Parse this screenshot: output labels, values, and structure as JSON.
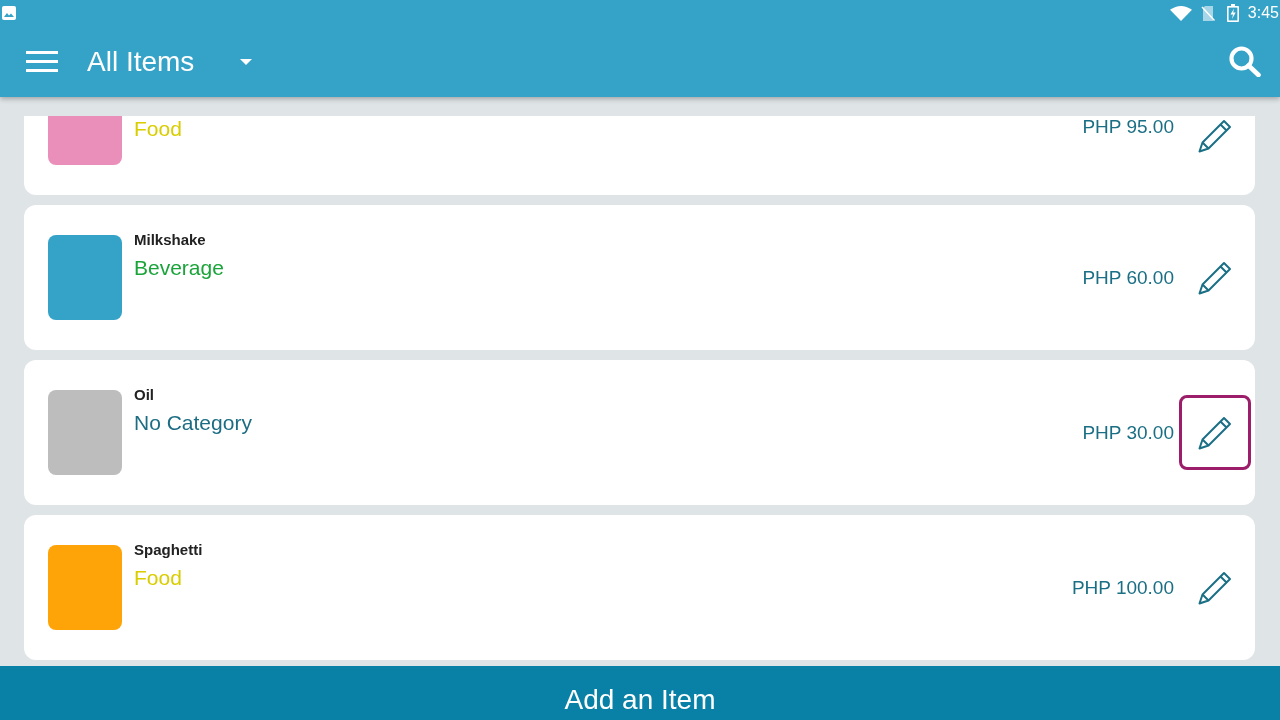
{
  "status_bar": {
    "time": "3:45"
  },
  "app_bar": {
    "title": "All Items"
  },
  "items": [
    {
      "kind": "cut",
      "color": "#ea8fb9",
      "category": {
        "label": "Food",
        "color": "#d9cd00"
      },
      "price": "PHP 95.00",
      "edit_focused": false
    },
    {
      "kind": "full",
      "name": "Milkshake",
      "color": "#35a2c8",
      "category": {
        "label": "Beverage",
        "color": "#1aa43a"
      },
      "price": "PHP 60.00",
      "edit_focused": false
    },
    {
      "kind": "full",
      "name": "Oil",
      "color": "#bdbdbd",
      "category": {
        "label": "No Category",
        "color": "#1c6d84"
      },
      "price": "PHP 30.00",
      "edit_focused": true
    },
    {
      "kind": "full",
      "name": "Spaghetti",
      "color": "#ffa408",
      "category": {
        "label": "Food",
        "color": "#d9cd00"
      },
      "price": "PHP 100.00",
      "edit_focused": false
    }
  ],
  "add_button": {
    "label": "Add an Item"
  }
}
